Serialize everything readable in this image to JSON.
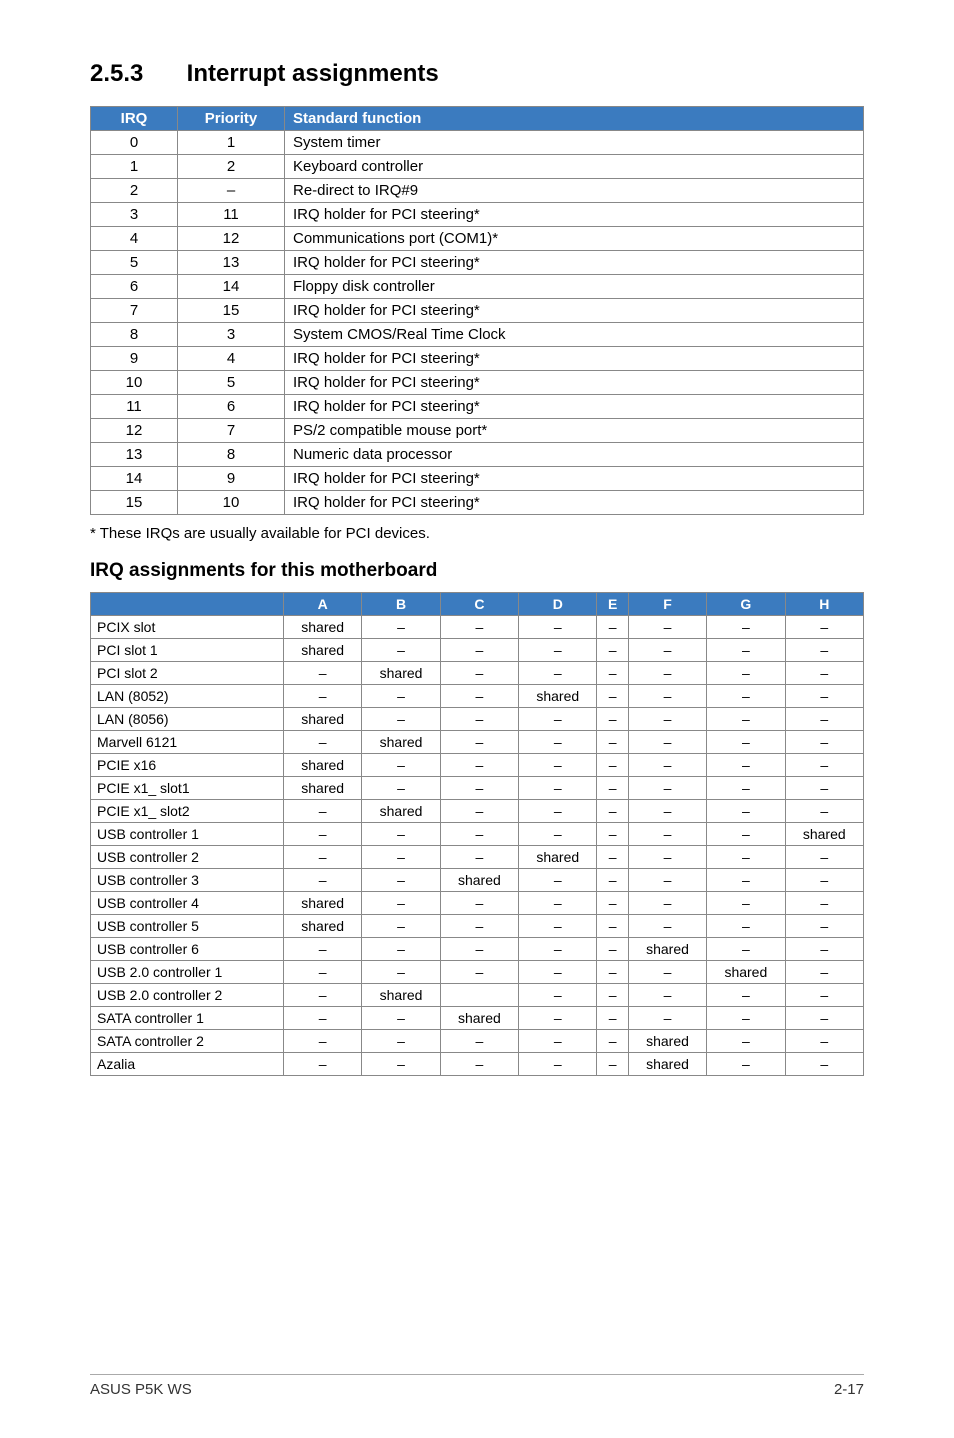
{
  "heading": {
    "number": "2.5.3",
    "title": "Interrupt assignments"
  },
  "irq_table": {
    "headers": [
      "IRQ",
      "Priority",
      "Standard function"
    ],
    "rows": [
      [
        "0",
        "1",
        "System timer"
      ],
      [
        "1",
        "2",
        "Keyboard controller"
      ],
      [
        "2",
        "–",
        "Re-direct to IRQ#9"
      ],
      [
        "3",
        "11",
        "IRQ holder for PCI steering*"
      ],
      [
        "4",
        "12",
        "Communications port (COM1)*"
      ],
      [
        "5",
        "13",
        "IRQ holder for PCI steering*"
      ],
      [
        "6",
        "14",
        "Floppy disk controller"
      ],
      [
        "7",
        "15",
        "IRQ holder for PCI steering*"
      ],
      [
        "8",
        "3",
        "System CMOS/Real Time Clock"
      ],
      [
        "9",
        "4",
        "IRQ holder for PCI steering*"
      ],
      [
        "10",
        "5",
        "IRQ holder for PCI steering*"
      ],
      [
        "11",
        "6",
        "IRQ holder for PCI steering*"
      ],
      [
        "12",
        "7",
        "PS/2 compatible mouse port*"
      ],
      [
        "13",
        "8",
        "Numeric data processor"
      ],
      [
        "14",
        "9",
        "IRQ holder for PCI steering*"
      ],
      [
        "15",
        "10",
        "IRQ holder for PCI steering*"
      ]
    ]
  },
  "note_text": "* These IRQs are usually available for PCI devices.",
  "subheading": "IRQ assignments for this motherboard",
  "assign_table": {
    "headers": [
      "",
      "A",
      "B",
      "C",
      "D",
      "E",
      "F",
      "G",
      "H"
    ],
    "rows": [
      [
        "PCIX slot",
        "shared",
        "–",
        "–",
        "–",
        "–",
        "–",
        "–",
        "–"
      ],
      [
        "PCI slot 1",
        "shared",
        "–",
        "–",
        "–",
        "–",
        "–",
        "–",
        "–"
      ],
      [
        "PCI slot 2",
        "–",
        "shared",
        "–",
        "–",
        "–",
        "–",
        "–",
        "–"
      ],
      [
        "LAN (8052)",
        "–",
        "–",
        "–",
        "shared",
        "–",
        "–",
        "–",
        "–"
      ],
      [
        "LAN (8056)",
        "shared",
        "–",
        "–",
        "–",
        "–",
        "–",
        "–",
        "–"
      ],
      [
        "Marvell 6121",
        "–",
        "shared",
        "–",
        "–",
        "–",
        "–",
        "–",
        "–"
      ],
      [
        "PCIE x16",
        "shared",
        "–",
        "–",
        "–",
        "–",
        "–",
        "–",
        "–"
      ],
      [
        "PCIE x1_ slot1",
        "shared",
        "–",
        "–",
        "–",
        "–",
        "–",
        "–",
        "–"
      ],
      [
        "PCIE x1_ slot2",
        "–",
        "shared",
        "–",
        "–",
        "–",
        "–",
        "–",
        "–"
      ],
      [
        "USB controller 1",
        "–",
        "–",
        "–",
        "–",
        "–",
        "–",
        "–",
        "shared"
      ],
      [
        "USB controller 2",
        "–",
        "–",
        "–",
        "shared",
        "–",
        "–",
        "–",
        "–"
      ],
      [
        "USB controller 3",
        "–",
        "–",
        "shared",
        "–",
        "–",
        "–",
        "–",
        "–"
      ],
      [
        "USB controller 4",
        "shared",
        "–",
        "–",
        "–",
        "–",
        "–",
        "–",
        "–"
      ],
      [
        "USB controller 5",
        "shared",
        "–",
        "–",
        "–",
        "–",
        "–",
        "–",
        "–"
      ],
      [
        "USB controller 6",
        "–",
        "–",
        "–",
        "–",
        "–",
        "shared",
        "–",
        "–"
      ],
      [
        "USB 2.0 controller 1",
        "–",
        "–",
        "–",
        "–",
        "–",
        "–",
        "shared",
        "–"
      ],
      [
        "USB 2.0 controller 2",
        "–",
        "shared",
        "",
        "–",
        "–",
        "–",
        "–",
        "–"
      ],
      [
        "SATA controller 1",
        "–",
        "–",
        "shared",
        "–",
        "–",
        "–",
        "–",
        "–"
      ],
      [
        "SATA controller 2",
        "–",
        "–",
        "–",
        "–",
        "–",
        "shared",
        "–",
        "–"
      ],
      [
        "Azalia",
        "–",
        "–",
        "–",
        "–",
        "–",
        "shared",
        "–",
        "–"
      ]
    ]
  },
  "footer": {
    "left": "ASUS P5K WS",
    "right": "2-17"
  }
}
